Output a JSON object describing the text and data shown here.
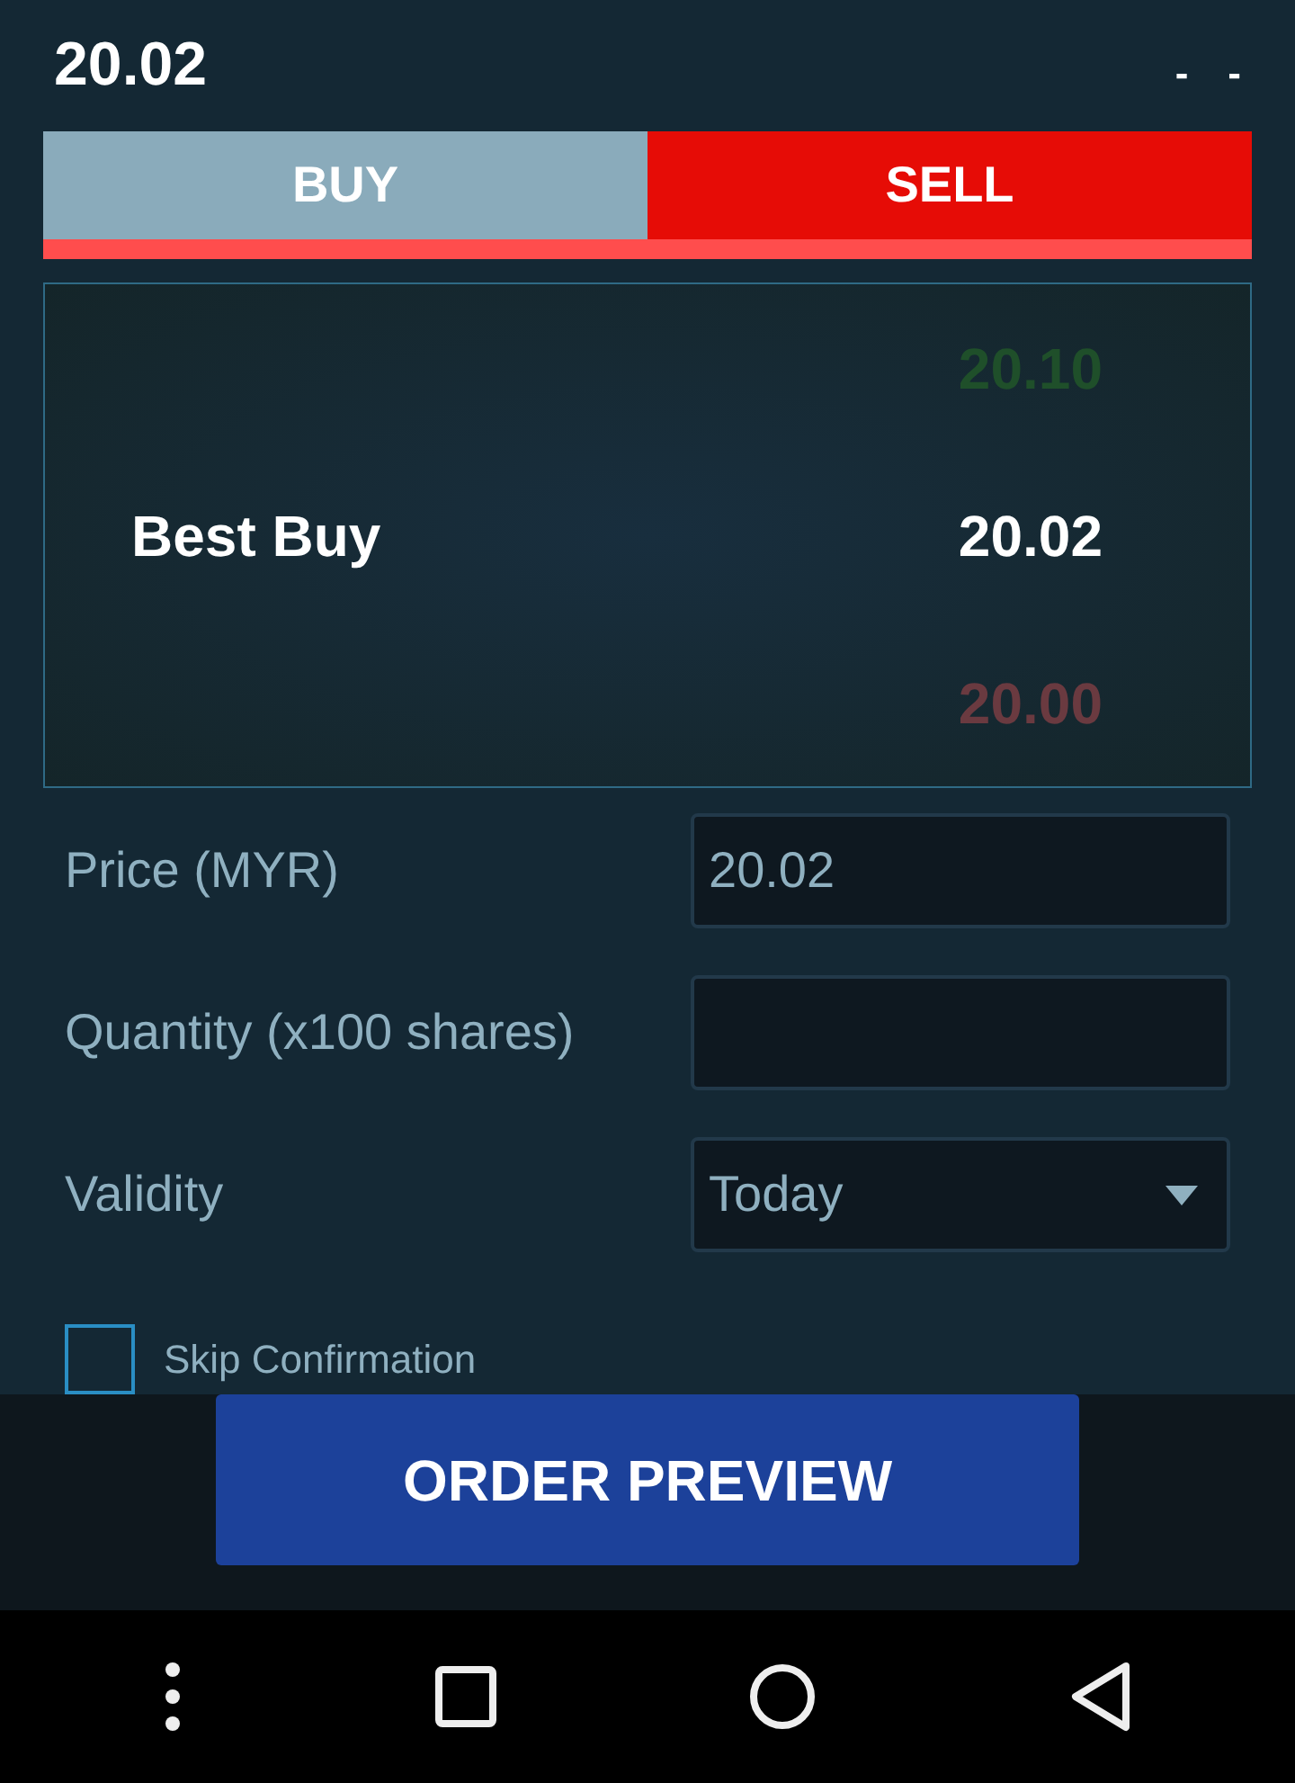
{
  "header": {
    "price": "20.02",
    "change": "-",
    "percent": "-"
  },
  "tabs": [
    {
      "label": "BUY",
      "selected": false
    },
    {
      "label": "SELL",
      "selected": true
    }
  ],
  "order_book": {
    "label": "Best Buy",
    "rows": [
      {
        "price": "20.10",
        "color": "#1f4f2a"
      },
      {
        "price": "20.02",
        "color": "#ffffff"
      },
      {
        "price": "20.00",
        "color": "#6a3a40"
      }
    ]
  },
  "fields": [
    {
      "kind": "input",
      "label": "Price (MYR)",
      "value": "20.02"
    },
    {
      "kind": "input",
      "label": "Quantity (x100 shares)"
    },
    {
      "kind": "select",
      "label": "Validity",
      "value": "Today"
    }
  ],
  "skip_confirmation": {
    "label": "Skip Confirmation",
    "checked": false
  },
  "order_button": "ORDER PREVIEW"
}
